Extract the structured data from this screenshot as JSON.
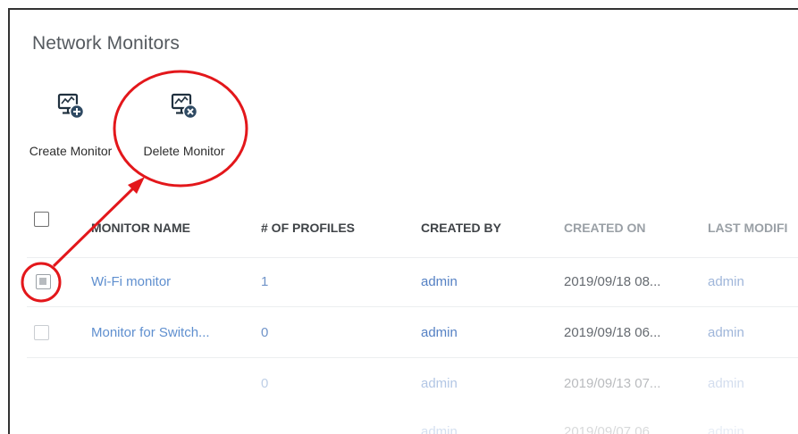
{
  "page": {
    "title": "Network Monitors"
  },
  "toolbar": {
    "create_label": "Create Monitor",
    "delete_label": "Delete Monitor",
    "create_icon": "monitor-add-icon",
    "delete_icon": "monitor-delete-icon"
  },
  "table": {
    "headers": [
      "MONITOR NAME",
      "# OF PROFILES",
      "CREATED BY",
      "CREATED ON",
      "LAST MODIFI"
    ],
    "rows": [
      {
        "name": "Wi-Fi monitor",
        "profiles": "1",
        "created_by": "admin",
        "created_on": "2019/09/18 08...",
        "last_modified_by": "admin",
        "checked": true
      },
      {
        "name": "Monitor for Switch...",
        "profiles": "0",
        "created_by": "admin",
        "created_on": "2019/09/18 06...",
        "last_modified_by": "admin",
        "checked": false
      },
      {
        "name": "",
        "profiles": "0",
        "created_by": "admin",
        "created_on": "2019/09/13 07...",
        "last_modified_by": "admin",
        "checked": false
      },
      {
        "name": "",
        "profiles": "",
        "created_by": "admin",
        "created_on": "2019/09/07 06...",
        "last_modified_by": "admin",
        "checked": false
      }
    ]
  },
  "colors": {
    "annotation": "#e3171b",
    "link": "#5f8fcf",
    "header": "#3f4347"
  }
}
